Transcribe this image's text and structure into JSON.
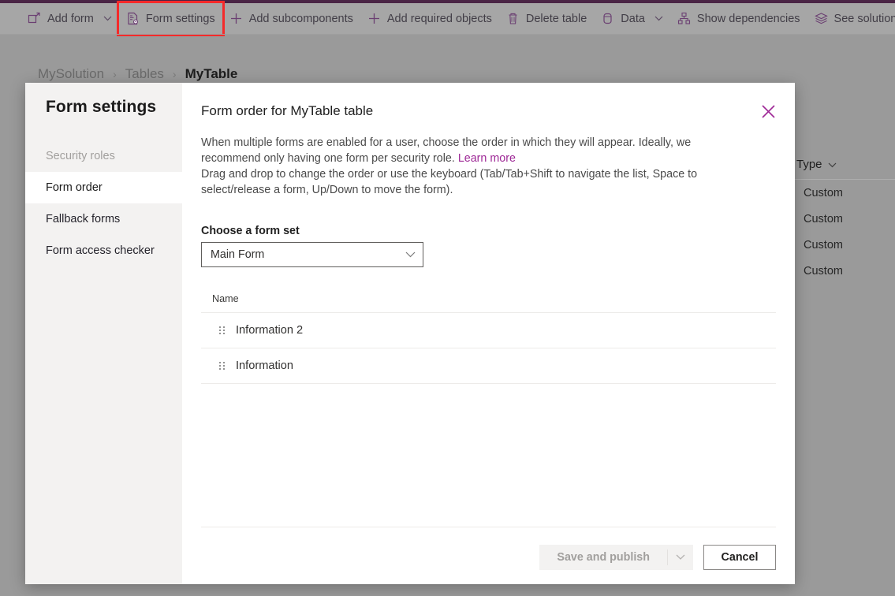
{
  "theme": {
    "accent_purple": "#4a2545",
    "link_purple": "#9e2896",
    "highlight_red": "#f52a2a",
    "nav_bg": "#f3f2f1",
    "dim_overlay": "#9a9a9a"
  },
  "command_bar": {
    "items": [
      {
        "label": "Add form",
        "icon": "add-form-icon",
        "has_chevron": true
      },
      {
        "label": "Form settings",
        "icon": "form-settings-icon",
        "has_chevron": false,
        "highlighted": true
      },
      {
        "label": "Add subcomponents",
        "icon": "plus-icon",
        "has_chevron": false
      },
      {
        "label": "Add required objects",
        "icon": "plus-icon",
        "has_chevron": false
      },
      {
        "label": "Delete table",
        "icon": "trash-icon",
        "has_chevron": false
      },
      {
        "label": "Data",
        "icon": "database-icon",
        "has_chevron": true
      },
      {
        "label": "Show dependencies",
        "icon": "dependencies-icon",
        "has_chevron": false
      },
      {
        "label": "See solution layers",
        "icon": "layers-icon",
        "has_chevron": false
      }
    ]
  },
  "breadcrumb": {
    "items": [
      {
        "label": "MySolution",
        "current": false
      },
      {
        "label": "Tables",
        "current": false
      },
      {
        "label": "MyTable",
        "current": true
      }
    ],
    "separator": "›"
  },
  "background_grid": {
    "column_header": "Type",
    "header_icon": "chevron-down-icon",
    "cells": [
      "Custom",
      "Custom",
      "Custom",
      "Custom"
    ]
  },
  "dialog": {
    "nav": {
      "title": "Form settings",
      "items": [
        {
          "label": "Security roles",
          "state": "disabled"
        },
        {
          "label": "Form order",
          "state": "active"
        },
        {
          "label": "Fallback forms",
          "state": "default"
        },
        {
          "label": "Form access checker",
          "state": "default"
        }
      ]
    },
    "header": {
      "title": "Form order for MyTable table",
      "close_icon": "close-icon"
    },
    "description": {
      "line1_part1": "When multiple forms are enabled for a user, choose the order in which they will appear. Ideally, we recommend only having one form per security role.",
      "learn_more": "Learn more",
      "line2": "Drag and drop to change the order or use the keyboard (Tab/Tab+Shift to navigate the list, Space to select/release a form, Up/Down to move the form)."
    },
    "form_set": {
      "label": "Choose a form set",
      "selected": "Main Form",
      "chevron_icon": "chevron-down-icon",
      "options": [
        "Main Form"
      ]
    },
    "form_list": {
      "column_header": "Name",
      "rows": [
        {
          "name": "Information 2",
          "handle_icon": "drag-handle-icon"
        },
        {
          "name": "Information",
          "handle_icon": "drag-handle-icon"
        }
      ]
    },
    "footer": {
      "primary_label": "Save and publish",
      "primary_disabled": true,
      "primary_chevron_icon": "chevron-down-icon",
      "cancel_label": "Cancel"
    }
  }
}
